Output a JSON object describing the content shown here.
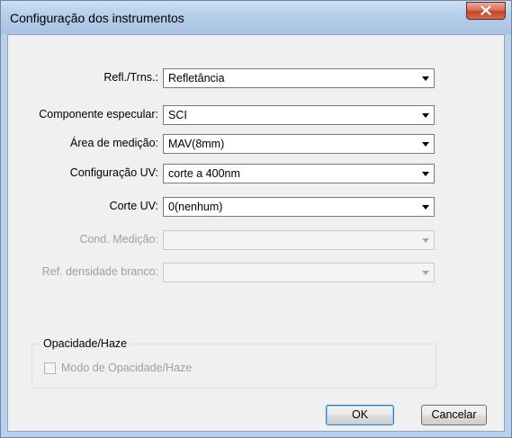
{
  "window": {
    "title": "Configuração dos instrumentos"
  },
  "fields": [
    {
      "label": "Refl./Trns.:",
      "value": "Refletância",
      "enabled": true
    },
    {
      "label": "Componente especular:",
      "value": "SCI",
      "enabled": true
    },
    {
      "label": "Área de medição:",
      "value": "MAV(8mm)",
      "enabled": true
    },
    {
      "label": "Configuração UV:",
      "value": "corte a 400nm",
      "enabled": true
    },
    {
      "label": "Corte UV:",
      "value": "0(nenhum)",
      "enabled": true
    },
    {
      "label": "Cond. Medição:",
      "value": "",
      "enabled": false
    },
    {
      "label": "Ref. densidade branco:",
      "value": "",
      "enabled": false
    }
  ],
  "group": {
    "title": "Opacidade/Haze",
    "checkbox_label": "Modo de Opacidade/Haze",
    "checked": false,
    "enabled": false
  },
  "buttons": {
    "ok": "OK",
    "cancel": "Cancelar"
  },
  "colors": {
    "titlebar": "#b4cde8",
    "close": "#c3462b",
    "disabled_text": "#a0a0a0"
  }
}
